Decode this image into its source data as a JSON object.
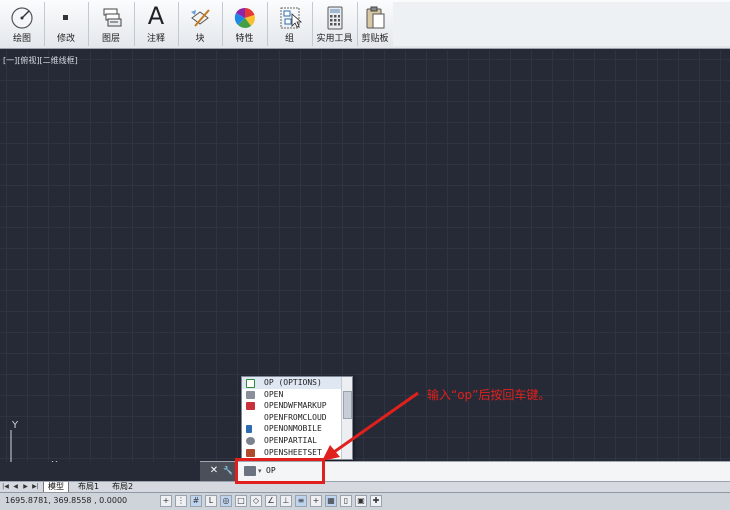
{
  "ribbon": {
    "panels": [
      {
        "label": "绘图",
        "icon": "draw-icon"
      },
      {
        "label": "修改",
        "icon": "modify-icon"
      },
      {
        "label": "图层",
        "icon": "layers-icon"
      },
      {
        "label": "注释",
        "icon": "annotation-icon"
      },
      {
        "label": "块",
        "icon": "block-icon"
      },
      {
        "label": "特性",
        "icon": "properties-icon"
      },
      {
        "label": "组",
        "icon": "group-icon"
      },
      {
        "label": "实用工具",
        "icon": "utilities-icon"
      },
      {
        "label": "剪贴板",
        "icon": "clipboard-icon"
      }
    ],
    "annotation_glyph": "A"
  },
  "viewport": {
    "label": "[一][俯视][二维线框]",
    "ucs_x": "X",
    "ucs_y": "Y"
  },
  "autocomplete": {
    "items": [
      {
        "label": "OP (OPTIONS)",
        "icon": "options-check-icon",
        "color": "#2f8a3a"
      },
      {
        "label": "OPEN",
        "icon": "open-folder-icon",
        "color": "#8a8f99"
      },
      {
        "label": "OPENDWFMARKUP",
        "icon": "dwf-markup-icon",
        "color": "#c8303a"
      },
      {
        "label": "OPENFROMCLOUD",
        "icon": "",
        "color": ""
      },
      {
        "label": "OPENONMOBILE",
        "icon": "mobile-icon",
        "color": "#2b6cb3"
      },
      {
        "label": "OPENPARTIAL",
        "icon": "gear-icon",
        "color": "#7c828c"
      },
      {
        "label": "OPENSHEETSET",
        "icon": "sheetset-icon",
        "color": "#b04a2c"
      }
    ]
  },
  "command_line": {
    "close_glyph": "✕",
    "settings_glyph": "🔧",
    "prompt_arrow": "▾",
    "value": "OP"
  },
  "layout_tabs": {
    "nav": [
      "|◀",
      "◀",
      "▶",
      "▶|"
    ],
    "tabs": [
      "模型",
      "布局1",
      "布局2"
    ],
    "active_index": 0
  },
  "status": {
    "coordinates": "1695.8781, 369.8558 , 0.0000"
  },
  "annotation": {
    "text": "输入“op”后按回车键。",
    "color": "#e0201c"
  }
}
